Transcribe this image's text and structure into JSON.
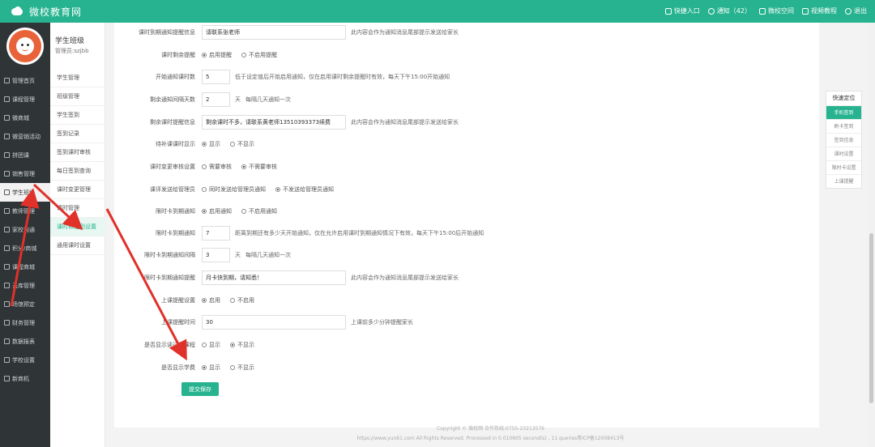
{
  "app": {
    "title": "微校教育网"
  },
  "topnav": [
    {
      "label": "快捷入口",
      "icon": "shortcut-icon"
    },
    {
      "label": "通知（42）",
      "icon": "share-icon"
    },
    {
      "label": "微校空间",
      "icon": "space-icon"
    },
    {
      "label": "视频教程",
      "icon": "video-icon"
    },
    {
      "label": "退出",
      "icon": "power-icon"
    }
  ],
  "sidebar": {
    "items": [
      {
        "label": "管理首页"
      },
      {
        "label": "课程管理"
      },
      {
        "label": "微商城"
      },
      {
        "label": "微营销活动"
      },
      {
        "label": "拼团课"
      },
      {
        "label": "销售管理"
      },
      {
        "label": "学生班级"
      },
      {
        "label": "教师管理"
      },
      {
        "label": "家校沟通"
      },
      {
        "label": "积分/商城"
      },
      {
        "label": "课程商城"
      },
      {
        "label": "云库管理"
      },
      {
        "label": "场馆预定"
      },
      {
        "label": "财务管理"
      },
      {
        "label": "数据报表"
      },
      {
        "label": "学校设置"
      },
      {
        "label": "新商机"
      }
    ]
  },
  "subside": {
    "title": "学生班级",
    "admin": "管理员:szjbb",
    "items": [
      {
        "label": "学生管理"
      },
      {
        "label": "班级管理"
      },
      {
        "label": "学生签到"
      },
      {
        "label": "签到记录"
      },
      {
        "label": "签到课时审核"
      },
      {
        "label": "每日签到查询"
      },
      {
        "label": "课时变更管理"
      },
      {
        "label": "课时管理"
      },
      {
        "label": "课时和签到设置"
      },
      {
        "label": "通用课时设置"
      }
    ]
  },
  "form": {
    "r1": {
      "label": "课时到期通知提醒信息",
      "value": "请联系张老师",
      "hint": "此内容会作为通知消息尾部提示发送给家长"
    },
    "r2": {
      "label": "课时剩余提醒",
      "opt1": "启用提醒",
      "opt2": "不启用提醒"
    },
    "r3": {
      "label": "开始通知课时数",
      "value": "5",
      "hint": "低于设定值后开始启用通知，仅在启用课时剩余提醒时有效，每天下午15:00开始通知"
    },
    "r4": {
      "label": "剩余通知间隔天数",
      "value": "2",
      "unit": "天",
      "hint": "每隔几天通知一次"
    },
    "r5": {
      "label": "剩余课时提醒信息",
      "value": "剩余课时不多，请联系黄老师13510393373续费",
      "hint": "此内容会作为通知消息尾部提示发送给家长"
    },
    "r6": {
      "label": "待补课课时显示",
      "opt1": "显示",
      "opt2": "不显示"
    },
    "r7": {
      "label": "课时变更审核设置",
      "opt1": "需要审核",
      "opt2": "不需要审核"
    },
    "r8": {
      "label": "课评发送给管理员",
      "opt1": "同时发送给管理员通知",
      "opt2": "不发送给管理员通知"
    },
    "r9": {
      "label": "限时卡到期通知",
      "opt1": "启用通知",
      "opt2": "不启用通知"
    },
    "r10": {
      "label": "限时卡到期通知",
      "value": "7",
      "hint": "距离到期还有多少天开始通知，仅在允许启用课时到期通知情况下有效，每天下午15:00后开始通知"
    },
    "r11": {
      "label": "限时卡到期通知间隔",
      "value": "3",
      "unit": "天",
      "hint": "每隔几天通知一次"
    },
    "r12": {
      "label": "限时卡到期通知提醒",
      "value": "月卡快到期，请知悉！",
      "hint": "此内容会作为通知消息尾部提示发送给家长"
    },
    "r13": {
      "label": "上课提醒设置",
      "opt1": "启用",
      "opt2": "不启用"
    },
    "r14": {
      "label": "上课提醒时间",
      "value": "30",
      "hint": "上课前多少分钟提醒家长"
    },
    "r15": {
      "label": "是否显示读过的课程",
      "opt1": "显示",
      "opt2": "不显示"
    },
    "r16": {
      "label": "是否显示学费",
      "opt1": "显示",
      "opt2": "不显示"
    },
    "save": "提交保存"
  },
  "quicknav": {
    "title": "快速定位",
    "items": [
      {
        "label": "手机签到"
      },
      {
        "label": "刷卡签到"
      },
      {
        "label": "签到信息"
      },
      {
        "label": "课时设置"
      },
      {
        "label": "限时卡设置"
      },
      {
        "label": "上课提醒"
      }
    ]
  },
  "footer": {
    "line1": "Copyright © 微校网 合作热线:0755-23213576",
    "line2": "https://www.yun61.com All Rights Reserved. Processed in 0.010605 second(s) , 11 queries粤ICP备12008413号"
  },
  "colors": {
    "brand": "#27b38f",
    "sidebar": "#2f3437",
    "arrow": "#e0312a"
  }
}
